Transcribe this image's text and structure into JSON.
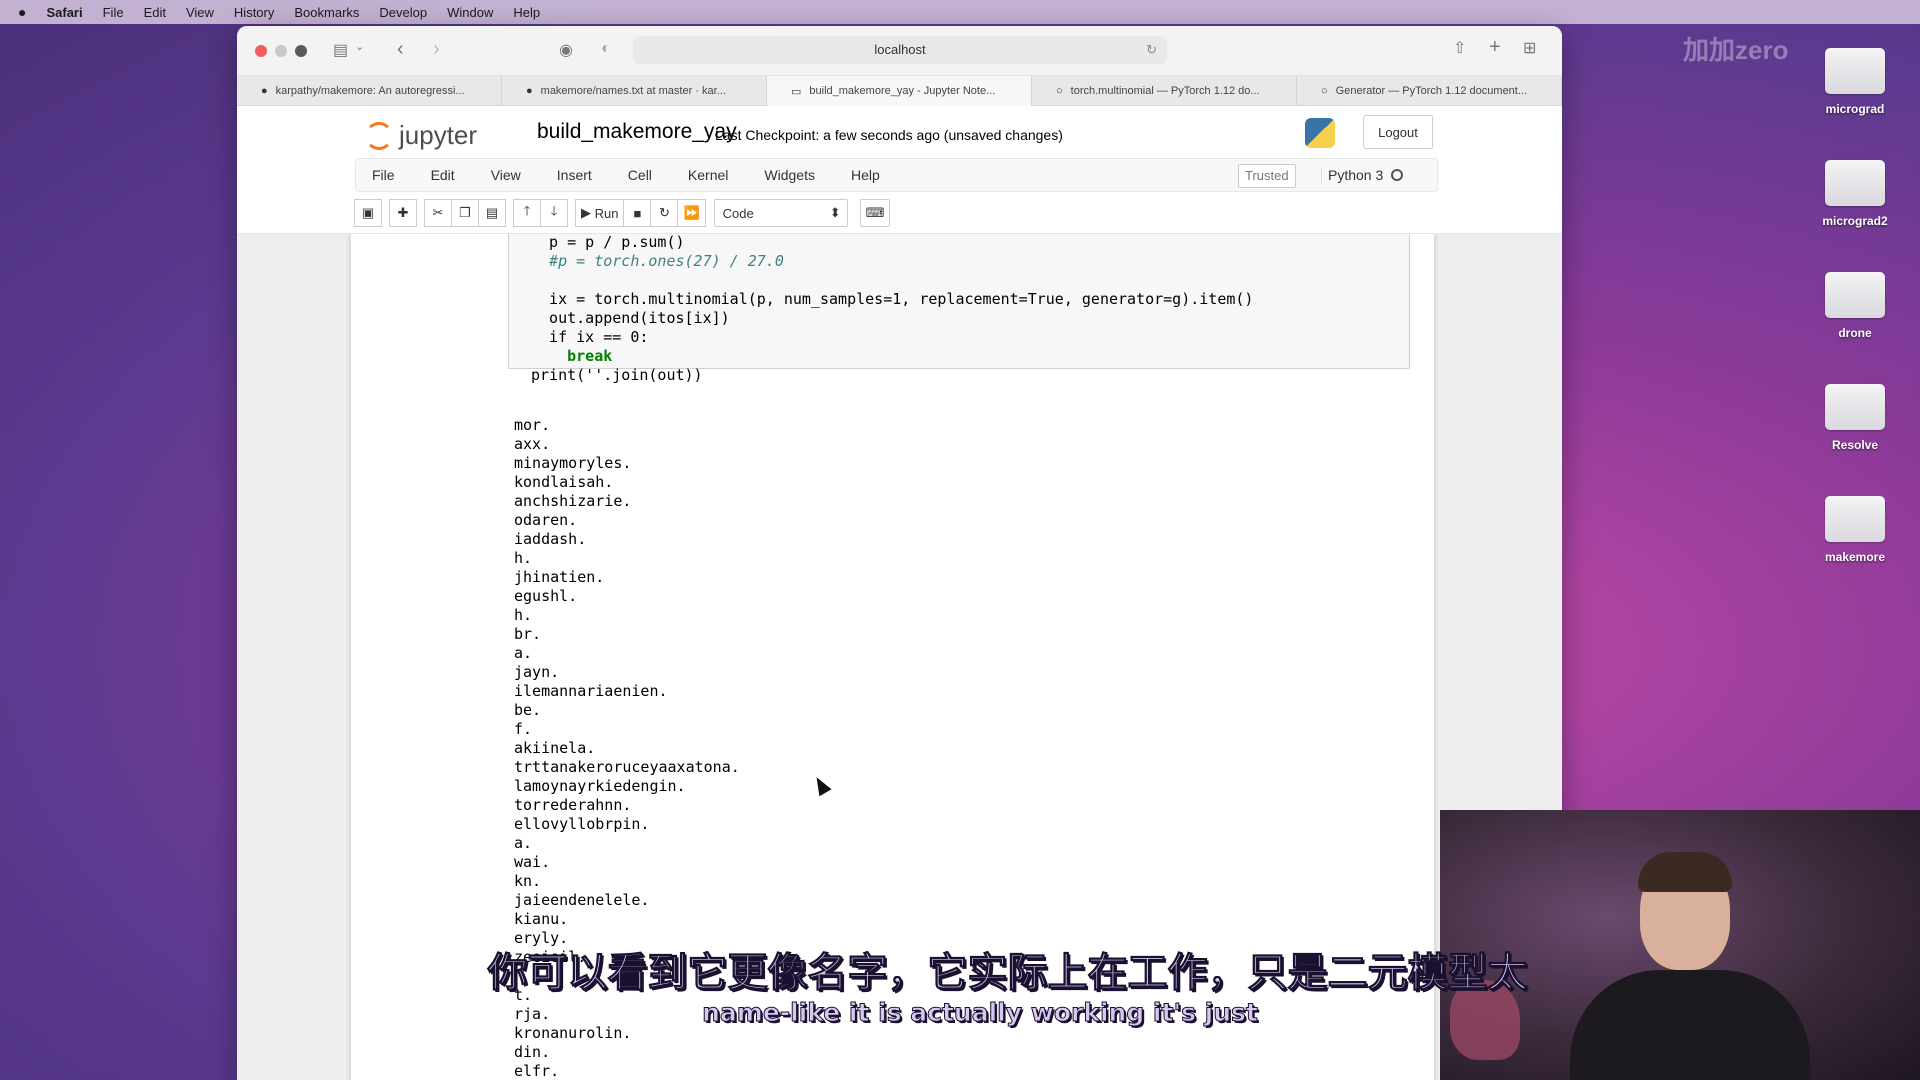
{
  "menubar": {
    "apple": "",
    "items": [
      "Safari",
      "File",
      "Edit",
      "View",
      "History",
      "Bookmarks",
      "Develop",
      "Window",
      "Help"
    ]
  },
  "desktop": {
    "watermark": "加加zero",
    "icons": [
      "micrograd",
      "micrograd2",
      "drone",
      "Resolve",
      "makemore"
    ]
  },
  "browser": {
    "url": "localhost",
    "tabs": [
      "karpathy/makemore: An autoregressi...",
      "makemore/names.txt at master · kar...",
      "build_makemore_yay - Jupyter Note...",
      "torch.multinomial — PyTorch 1.12 do...",
      "Generator — PyTorch 1.12 document..."
    ]
  },
  "jupyter": {
    "logo_text": "jupyter",
    "notebook_title": "build_makemore_yay",
    "checkpoint": "Last Checkpoint: a few seconds ago  (unsaved changes)",
    "logout": "Logout",
    "menu": [
      "File",
      "Edit",
      "View",
      "Insert",
      "Cell",
      "Kernel",
      "Widgets",
      "Help"
    ],
    "trusted": "Trusted",
    "kernel": "Python 3",
    "toolbar": {
      "run_label": "Run",
      "cell_type": "Code"
    }
  },
  "cell": {
    "code_lines": [
      "  p = p / p.sum()",
      "  #p = torch.ones(27) / 27.0",
      "",
      "  ix = torch.multinomial(p, num_samples=1, replacement=True, generator=g).item()",
      "  out.append(itos[ix])",
      "  if ix == 0:",
      "    break",
      "print(''.join(out))"
    ],
    "output_lines": [
      "mor.",
      "axx.",
      "minaymoryles.",
      "kondlaisah.",
      "anchshizarie.",
      "odaren.",
      "iaddash.",
      "h.",
      "jhinatien.",
      "egushl.",
      "h.",
      "br.",
      "a.",
      "jayn.",
      "ilemannariaenien.",
      "be.",
      "f.",
      "akiinela.",
      "trttanakeroruceyaaxatona.",
      "lamoynayrkiedengin.",
      "torrederahnn.",
      "ellovyllobrpin.",
      "a.",
      "wai.",
      "kn.",
      "jaieendenelele.",
      "kianu.",
      "eryly.",
      "zeeieil.",
      "",
      "t.",
      "rja.",
      "kronanurolin.",
      "din.",
      "elfr."
    ]
  },
  "subtitles": {
    "chinese": "你可以看到它更像名字，它实际上在工作，只是二元模型太",
    "english": "name-like it is actually working it's just"
  }
}
